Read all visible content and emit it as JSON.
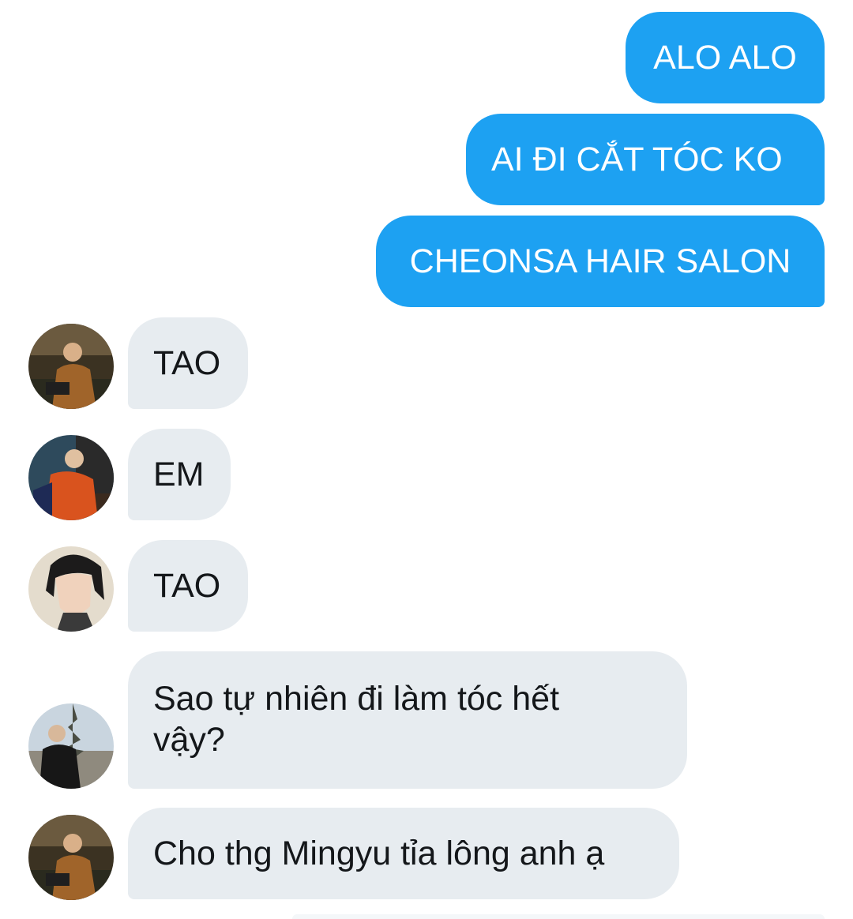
{
  "conversation": {
    "outgoing": [
      {
        "text": "ALO ALO"
      },
      {
        "text": "AI ĐI CẮT TÓC KO"
      },
      {
        "text": "CHEONSA HAIR SALON"
      }
    ],
    "incoming": [
      {
        "text": "TAO",
        "avatar": "user-avatar-1"
      },
      {
        "text": "EM",
        "avatar": "user-avatar-2"
      },
      {
        "text": "TAO",
        "avatar": "user-avatar-3"
      },
      {
        "text": "Sao tự nhiên đi làm tóc hết vậy?",
        "avatar": "user-avatar-4"
      },
      {
        "text": "Cho thg Mingyu tỉa lông anh ạ",
        "avatar": "user-avatar-1"
      }
    ]
  },
  "colors": {
    "outgoing_bubble": "#1da1f2",
    "incoming_bubble": "#e7ecf0",
    "outgoing_text": "#ffffff",
    "incoming_text": "#14171a"
  }
}
